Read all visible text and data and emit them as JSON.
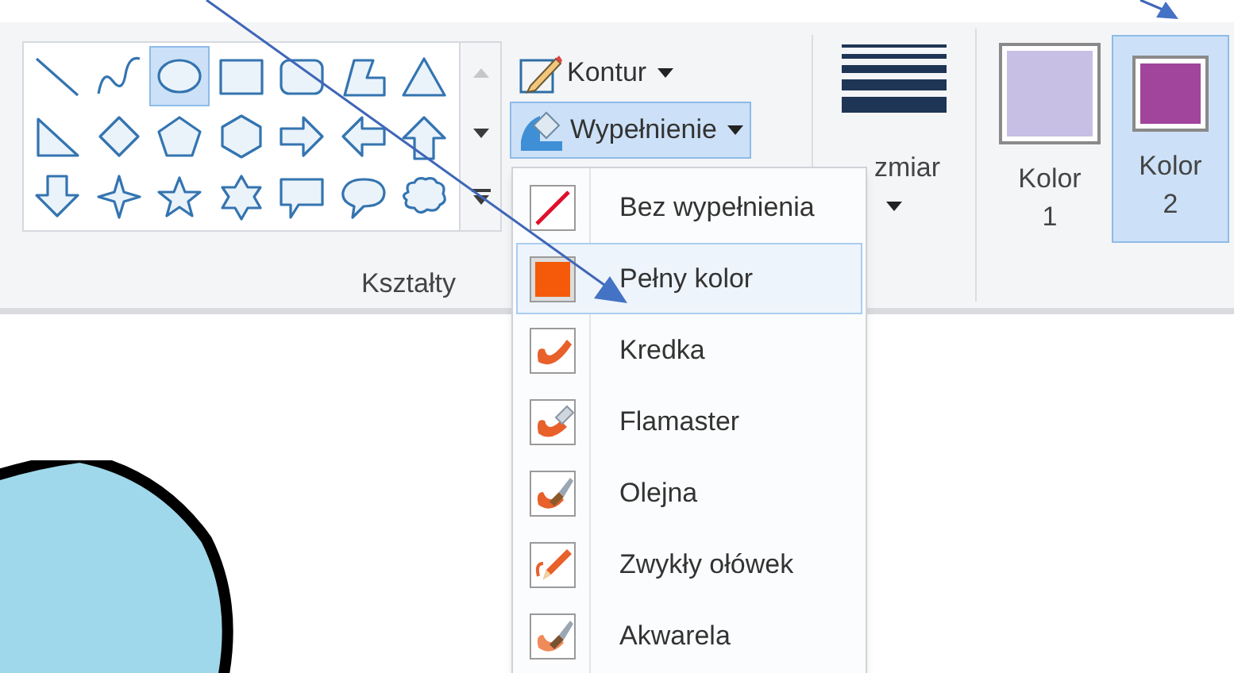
{
  "shapes": [
    {
      "kind": "line",
      "selected": false
    },
    {
      "kind": "curve",
      "selected": false
    },
    {
      "kind": "oval",
      "selected": true
    },
    {
      "kind": "rectangle",
      "selected": false
    },
    {
      "kind": "rounded-rectangle",
      "selected": false
    },
    {
      "kind": "polygon",
      "selected": false
    },
    {
      "kind": "triangle",
      "selected": false
    },
    {
      "kind": "right-triangle",
      "selected": false
    },
    {
      "kind": "diamond",
      "selected": false
    },
    {
      "kind": "pentagon",
      "selected": false
    },
    {
      "kind": "hexagon",
      "selected": false
    },
    {
      "kind": "arrow-right",
      "selected": false
    },
    {
      "kind": "arrow-left",
      "selected": false
    },
    {
      "kind": "arrow-up",
      "selected": false
    },
    {
      "kind": "arrow-down",
      "selected": false
    },
    {
      "kind": "star4",
      "selected": false
    },
    {
      "kind": "star5",
      "selected": false
    },
    {
      "kind": "star6",
      "selected": false
    },
    {
      "kind": "callout-rect",
      "selected": false
    },
    {
      "kind": "callout-oval",
      "selected": false
    },
    {
      "kind": "callout-cloud",
      "selected": false
    }
  ],
  "shapes_group": {
    "label": "Kształty"
  },
  "outline_button": {
    "label": "Kontur",
    "pressed": false
  },
  "fill_button": {
    "label": "Wypełnienie",
    "pressed": true
  },
  "size_group": {
    "label": "zmiar"
  },
  "colors": [
    {
      "label_1": "Kolor",
      "label_2": "1",
      "color": "#c8bfe4",
      "selected": false
    },
    {
      "label_1": "Kolor",
      "label_2": "2",
      "color": "#a0449c",
      "selected": true
    }
  ],
  "fill_menu": [
    {
      "kind": "none",
      "label": "Bez wypełnienia",
      "selected": false
    },
    {
      "kind": "solid",
      "label": "Pełny kolor",
      "selected": true
    },
    {
      "kind": "crayon",
      "label": "Kredka",
      "selected": false
    },
    {
      "kind": "marker",
      "label": "Flamaster",
      "selected": false
    },
    {
      "kind": "oil",
      "label": "Olejna",
      "selected": false
    },
    {
      "kind": "pencil",
      "label": "Zwykły ołówek",
      "selected": false
    },
    {
      "kind": "watercolor",
      "label": "Akwarela",
      "selected": false
    }
  ]
}
